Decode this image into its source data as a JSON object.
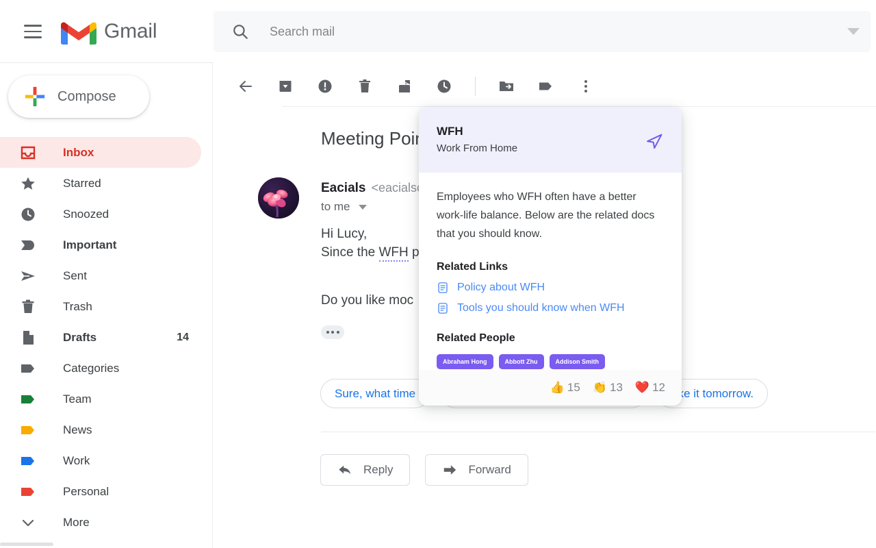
{
  "app": {
    "brand": "Gmail"
  },
  "search": {
    "placeholder": "Search mail",
    "value": ""
  },
  "compose": {
    "label": "Compose"
  },
  "sidebar": {
    "items": [
      {
        "label": "Inbox",
        "icon": "inbox-icon",
        "count": "",
        "active": true,
        "bold": true
      },
      {
        "label": "Starred",
        "icon": "star-icon",
        "count": "",
        "active": false,
        "bold": false
      },
      {
        "label": "Snoozed",
        "icon": "clock-icon",
        "count": "",
        "active": false,
        "bold": false
      },
      {
        "label": "Important",
        "icon": "important-icon",
        "count": "",
        "active": false,
        "bold": true
      },
      {
        "label": "Sent",
        "icon": "send-icon",
        "count": "",
        "active": false,
        "bold": false
      },
      {
        "label": "Trash",
        "icon": "trash-icon",
        "count": "",
        "active": false,
        "bold": false
      },
      {
        "label": "Drafts",
        "icon": "draft-icon",
        "count": "14",
        "active": false,
        "bold": true
      },
      {
        "label": "Categories",
        "icon": "label-icon",
        "count": "",
        "active": false,
        "bold": false
      },
      {
        "label": "Team",
        "icon": "label-icon",
        "count": "",
        "active": false,
        "bold": false
      },
      {
        "label": "News",
        "icon": "label-icon",
        "count": "",
        "active": false,
        "bold": false
      },
      {
        "label": "Work",
        "icon": "label-icon",
        "count": "",
        "active": false,
        "bold": false
      },
      {
        "label": "Personal",
        "icon": "label-icon",
        "count": "",
        "active": false,
        "bold": false
      },
      {
        "label": "More",
        "icon": "chevron-down-icon",
        "count": "",
        "active": false,
        "bold": false
      }
    ],
    "label_colors": {
      "Categories": "#5f6368",
      "Team": "#188038",
      "News": "#f9ab00",
      "Work": "#1a73e8",
      "Personal": "#ea4335"
    }
  },
  "toolbar": {
    "buttons": [
      "back-icon",
      "archive-icon",
      "report-spam-icon",
      "delete-icon",
      "mark-unread-icon",
      "snooze-icon",
      "move-to-icon",
      "label-icon",
      "more-options-icon"
    ]
  },
  "mail": {
    "subject": "Meeting Point",
    "sender_name": "Eacials",
    "sender_email": "<eacialso",
    "to": "to me",
    "body_line_1": "Hi Lucy,",
    "body_line_2_prefix": "Since the ",
    "body_line_2_link": "WFH",
    "body_line_2_suffix": " p",
    "body_line_3": "Do you like moc",
    "smart_replies": [
      "Sure, what time",
      "ake it tomorrow."
    ],
    "actions": [
      {
        "label": "Reply",
        "icon": "reply-icon"
      },
      {
        "label": "Forward",
        "icon": "forward-icon"
      }
    ]
  },
  "popup": {
    "title": "WFH",
    "subtitle": "Work From Home",
    "send_icon": "send-plane-icon",
    "description": "Employees who WFH often have a better work-life balance. Below are the related docs that you should know.",
    "related_links_heading": "Related Links",
    "links": [
      {
        "label": "Policy about WFH",
        "icon": "document-icon"
      },
      {
        "label": "Tools you should know when WFH",
        "icon": "document-icon"
      }
    ],
    "related_people_heading": "Related People",
    "people": [
      "Abraham Hong",
      "Abbott Zhu",
      "Addison Smith"
    ],
    "reactions": [
      {
        "emoji": "👍",
        "count": "15",
        "name": "thumbs-up-reaction"
      },
      {
        "emoji": "👏",
        "count": "13",
        "name": "clap-reaction"
      },
      {
        "emoji": "❤️",
        "count": "12",
        "name": "heart-reaction"
      }
    ],
    "accent_color": "#7b5cf0",
    "header_bg": "#f0effc"
  }
}
